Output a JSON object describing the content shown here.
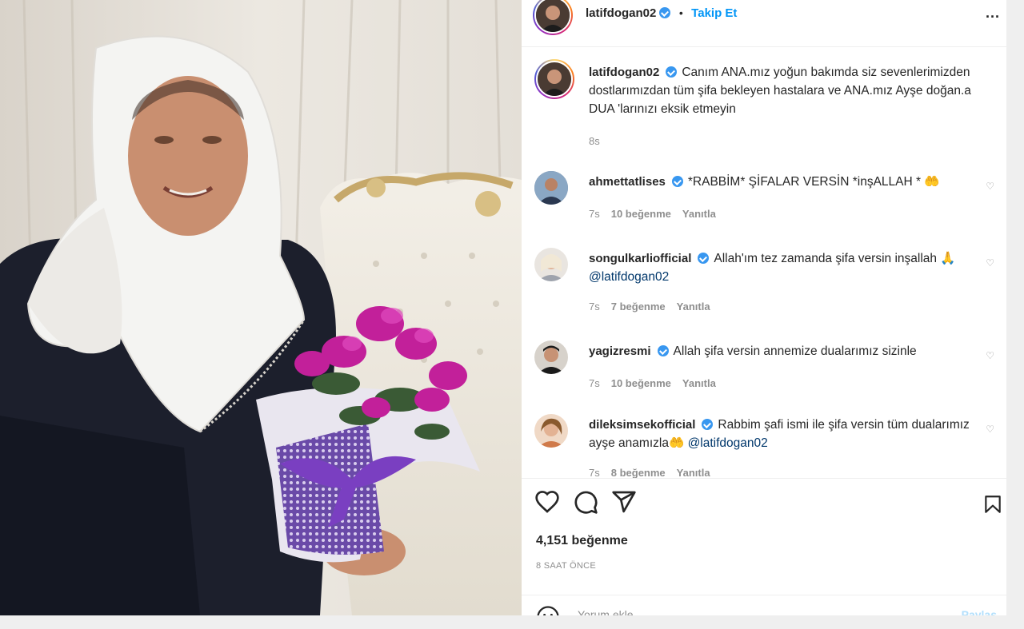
{
  "post": {
    "author": "latifdogan02",
    "follow_label": "Takip Et",
    "separator": "•",
    "more_label": "...",
    "caption": "Canım ANA.mız yoğun bakımda siz sevenlerimizden dostlarımızdan tüm şifa bekleyen hastalara ve ANA.mız Ayşe doğan.a DUA 'larınızı eksik etmeyin",
    "caption_time": "8s",
    "likes": "4,151 beğenme",
    "time_ago": "8 SAAT ÖNCE",
    "add_comment_placeholder": "Yorum ekle...",
    "post_button": "Paylaş"
  },
  "comments": [
    {
      "user": "ahmettatlises",
      "text": "*RABBİM* ŞİFALAR VERSİN *inşALLAH * 🤲",
      "mention": "",
      "time": "7s",
      "likes": "10 beğenme",
      "reply": "Yanıtla"
    },
    {
      "user": "songulkarliofficial",
      "text": "Allah'ım tez zamanda şifa versin inşallah 🙏",
      "mention": "@latifdogan02",
      "time": "7s",
      "likes": "7 beğenme",
      "reply": "Yanıtla"
    },
    {
      "user": "yagizresmi",
      "text": "Allah şifa versin annemize dualarımız sizinle",
      "mention": "",
      "time": "7s",
      "likes": "10 beğenme",
      "reply": "Yanıtla"
    },
    {
      "user": "dileksimsekofficial",
      "text": "Rabbim şafi ismi ile şifa versin tüm dualarımız ayşe anamızla🤲",
      "mention": "@latifdogan02",
      "time": "7s",
      "likes": "8 beğenme",
      "reply": "Yanıtla"
    }
  ],
  "icons": {
    "like": "heart-icon",
    "comment": "comment-icon",
    "share": "send-icon",
    "save": "bookmark-icon",
    "emoji": "smile-icon",
    "verified": "verified-badge-icon"
  },
  "colors": {
    "link_blue": "#0095f6",
    "verified_blue": "#3897f0",
    "text": "#262626",
    "muted": "#8e8e8e"
  }
}
